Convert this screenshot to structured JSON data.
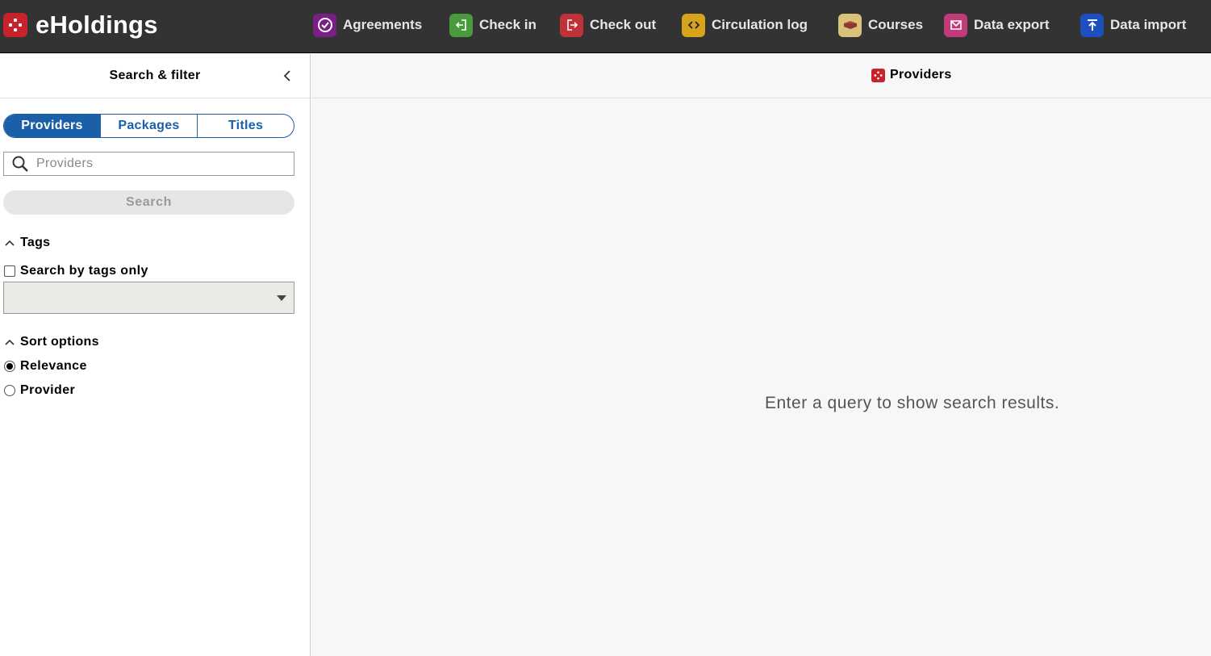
{
  "app": {
    "title": "eHoldings",
    "brand_color": "#c8232c",
    "brand_icon": "eholdings-logo-icon"
  },
  "nav": [
    {
      "label": "Agreements",
      "icon": "agreements-icon",
      "color": "#7a1f86"
    },
    {
      "label": "Check in",
      "icon": "check-in-icon",
      "color": "#4a9a3d"
    },
    {
      "label": "Check out",
      "icon": "check-out-icon",
      "color": "#c0323a"
    },
    {
      "label": "Circulation log",
      "icon": "circulation-log-icon",
      "color": "#d6a31b"
    },
    {
      "label": "Courses",
      "icon": "courses-icon",
      "color": "#d9c37a"
    },
    {
      "label": "Data export",
      "icon": "data-export-icon",
      "color": "#c23a7a"
    },
    {
      "label": "Data import",
      "icon": "data-import-icon",
      "color": "#1e4fc0"
    }
  ],
  "filter_pane": {
    "title": "Search & filter",
    "tabs": [
      {
        "label": "Providers",
        "active": true
      },
      {
        "label": "Packages",
        "active": false
      },
      {
        "label": "Titles",
        "active": false
      }
    ],
    "search": {
      "placeholder": "Providers",
      "value": ""
    },
    "search_button": "Search",
    "tags": {
      "heading": "Tags",
      "checkbox_label": "Search by tags only",
      "checked": false,
      "select_value": ""
    },
    "sort": {
      "heading": "Sort options",
      "options": [
        {
          "label": "Relevance",
          "selected": true
        },
        {
          "label": "Provider",
          "selected": false
        }
      ]
    }
  },
  "results_pane": {
    "title": "Providers",
    "empty_message": "Enter a query to show search results."
  },
  "colors": {
    "accent": "#1a5fa8",
    "topbar": "#333333"
  }
}
